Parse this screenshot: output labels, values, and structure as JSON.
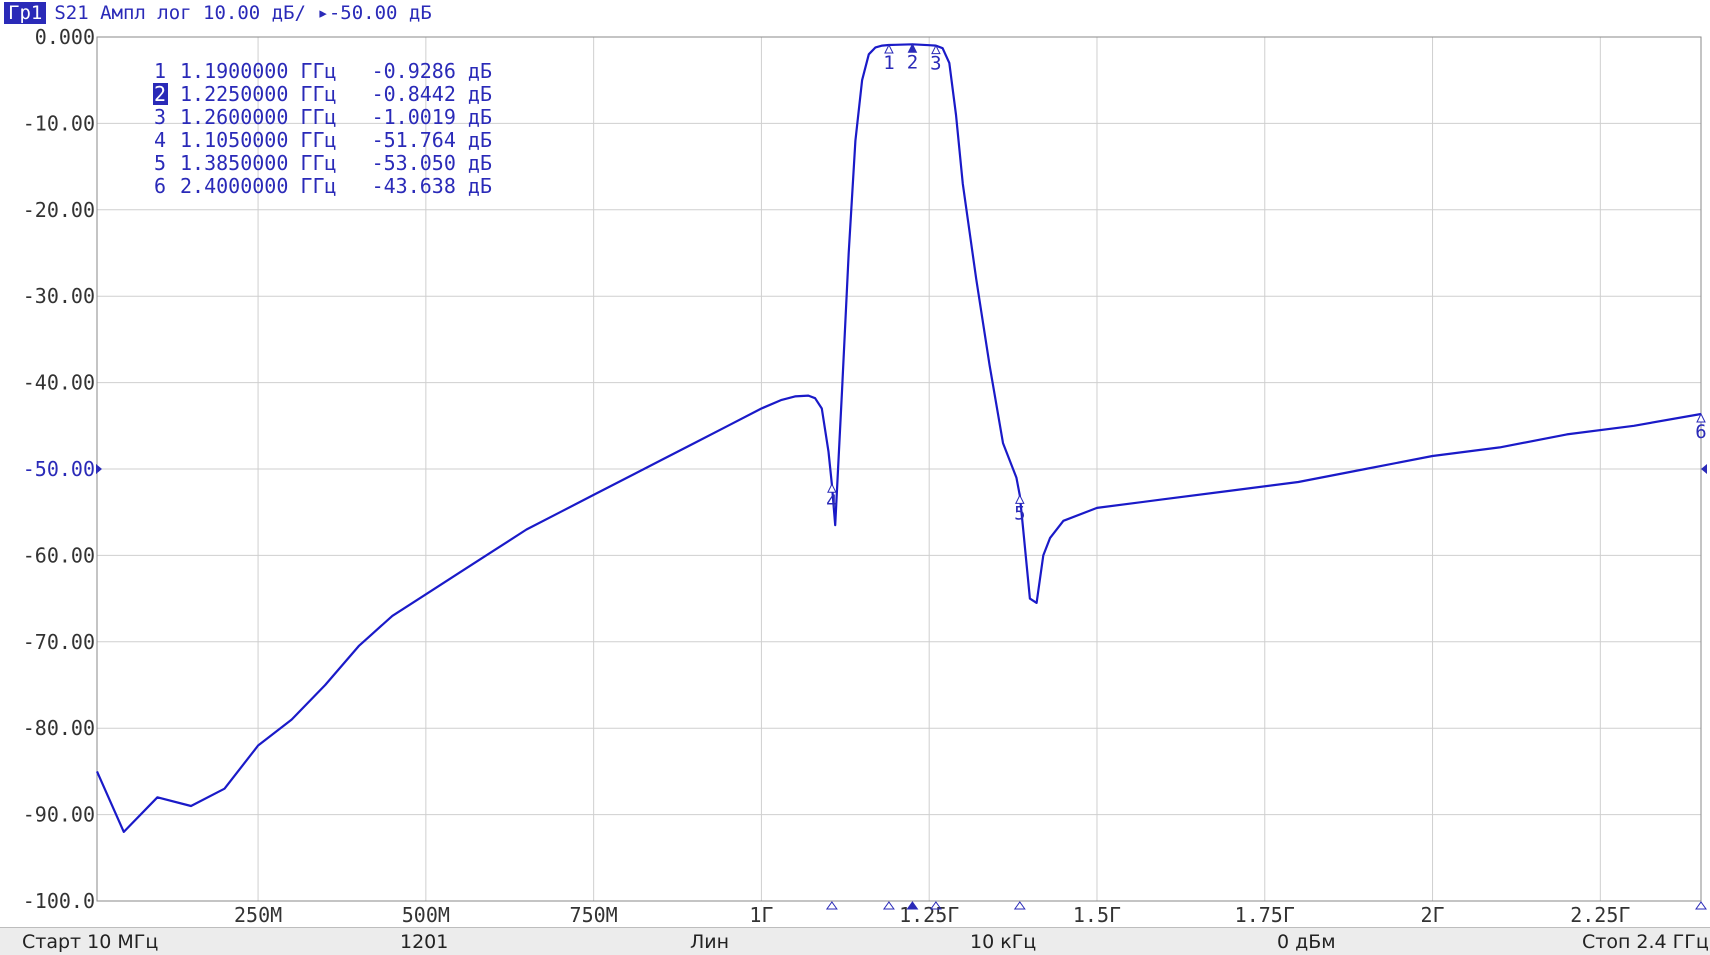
{
  "header": {
    "tag": "Гр1",
    "text": "S21 Ампл лог 10.00 дБ/ ▸-50.00 дБ"
  },
  "footer": {
    "start": "Старт 10 МГц",
    "points": "1201",
    "sweep": "Лин",
    "ifbw": "10 кГц",
    "power": "0 дБм",
    "stop": "Стоп 2.4 ГГц"
  },
  "colors": {
    "trace": "#1a1ac8",
    "text": "#2a2ab8",
    "axis_text": "#333333",
    "grid": "#cfcfcf"
  },
  "chart_data": {
    "type": "line",
    "xlim": [
      0.01,
      2.4
    ],
    "ylim": [
      -100,
      0
    ],
    "grid": true,
    "reference_level": -50,
    "y_ticks": [
      0,
      -10,
      -20,
      -30,
      -40,
      -50,
      -60,
      -70,
      -80,
      -90,
      -100
    ],
    "y_tick_labels": [
      "0.000",
      "-10.00",
      "-20.00",
      "-30.00",
      "-40.00",
      "-50.00",
      "-60.00",
      "-70.00",
      "-80.00",
      "-90.00",
      "-100.0"
    ],
    "x_ticks": [
      0.25,
      0.5,
      0.75,
      1.0,
      1.25,
      1.5,
      1.75,
      2.0,
      2.25
    ],
    "x_tick_labels": [
      "250М",
      "500М",
      "750М",
      "1Г",
      "1.25Г",
      "1.5Г",
      "1.75Г",
      "2Г",
      "2.25Г"
    ],
    "markers": [
      {
        "num": "1",
        "freq": "1.1900000 ГГц",
        "val": "-0.9286 дБ",
        "x": 1.19,
        "y": -0.9286,
        "active": false
      },
      {
        "num": "2",
        "freq": "1.2250000 ГГц",
        "val": "-0.8442 дБ",
        "x": 1.225,
        "y": -0.8442,
        "active": true
      },
      {
        "num": "3",
        "freq": "1.2600000 ГГц",
        "val": "-1.0019 дБ",
        "x": 1.26,
        "y": -1.0019,
        "active": false
      },
      {
        "num": "4",
        "freq": "1.1050000 ГГц",
        "val": "-51.764 дБ",
        "x": 1.105,
        "y": -51.764,
        "active": false
      },
      {
        "num": "5",
        "freq": "1.3850000 ГГц",
        "val": "-53.050 дБ",
        "x": 1.385,
        "y": -53.05,
        "active": false
      },
      {
        "num": "6",
        "freq": "2.4000000 ГГц",
        "val": "-43.638 дБ",
        "x": 2.4,
        "y": -43.638,
        "active": false
      }
    ],
    "series": [
      {
        "x": [
          0.01,
          0.05,
          0.1,
          0.15,
          0.2,
          0.25,
          0.3,
          0.35,
          0.4,
          0.45,
          0.5,
          0.55,
          0.6,
          0.65,
          0.7,
          0.75,
          0.8,
          0.85,
          0.9,
          0.95,
          1.0,
          1.03,
          1.05,
          1.07,
          1.08,
          1.09,
          1.1,
          1.105,
          1.11,
          1.12,
          1.13,
          1.14,
          1.15,
          1.16,
          1.17,
          1.18,
          1.19,
          1.2,
          1.225,
          1.25,
          1.26,
          1.27,
          1.28,
          1.29,
          1.3,
          1.32,
          1.34,
          1.36,
          1.38,
          1.385,
          1.39,
          1.4,
          1.41,
          1.42,
          1.43,
          1.45,
          1.5,
          1.6,
          1.7,
          1.8,
          1.9,
          2.0,
          2.1,
          2.2,
          2.3,
          2.4
        ],
        "y": [
          -85,
          -92,
          -88,
          -89,
          -87,
          -82,
          -79,
          -75,
          -70.5,
          -67,
          -64.5,
          -62,
          -59.5,
          -57,
          -55,
          -53,
          -51,
          -49,
          -47,
          -45,
          -43,
          -42,
          -41.6,
          -41.5,
          -41.8,
          -43,
          -48,
          -51.8,
          -56.5,
          -41,
          -25,
          -12,
          -5,
          -2,
          -1.2,
          -1.0,
          -0.93,
          -0.9,
          -0.84,
          -0.95,
          -1.0,
          -1.3,
          -3,
          -9,
          -17,
          -28,
          -38,
          -47,
          -51,
          -53.05,
          -57,
          -65,
          -65.5,
          -60,
          -58,
          -56,
          -54.5,
          -53.5,
          -52.5,
          -51.5,
          -50,
          -48.5,
          -47.5,
          -46,
          -45,
          -43.64
        ]
      }
    ]
  }
}
